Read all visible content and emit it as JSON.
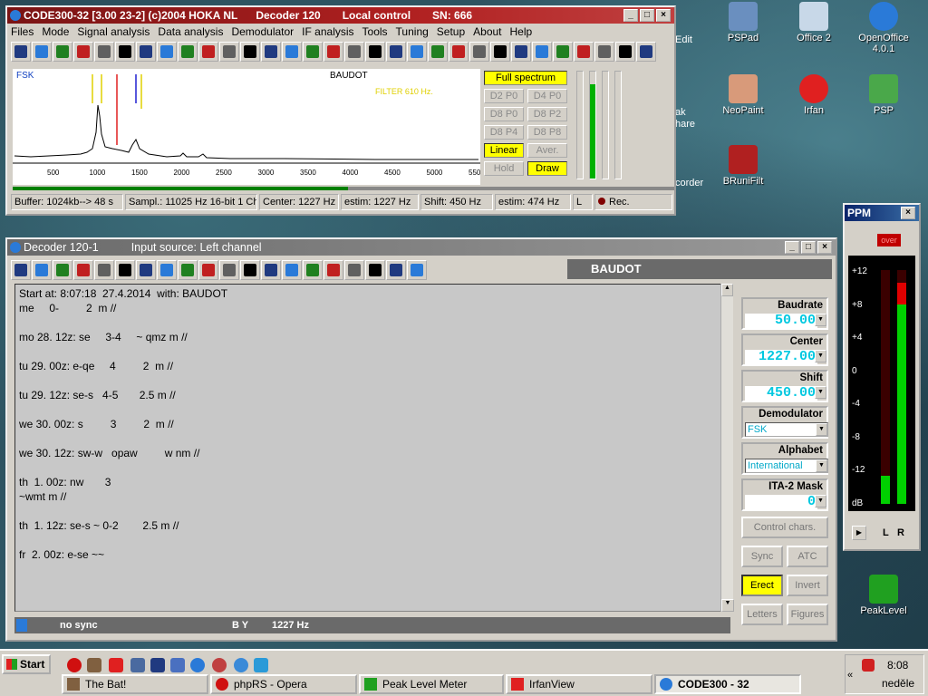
{
  "desktop": {
    "icons": [
      {
        "label": "PSPad",
        "color": "#6a8fbf"
      },
      {
        "label": "Office 2",
        "color": "#c8d8e8"
      },
      {
        "label": "OpenOffice\n4.0.1",
        "color": "#2a7ad8"
      },
      {
        "label": "NeoPaint",
        "color": "#d89a7a"
      },
      {
        "label": "Irfan",
        "color": "#e02020"
      },
      {
        "label": "PSP",
        "color": "#4aa84a"
      },
      {
        "label": "BRuniFilt",
        "color": "#b02020"
      },
      {
        "label": "PeakLevel",
        "color": "#20a020"
      }
    ],
    "partial_labels": [
      "Edit",
      "ak",
      "hare",
      "corder"
    ]
  },
  "main_window": {
    "title": "CODE300-32 [3.00 23-2] (c)2004 HOKA NL",
    "decoder": "Decoder 120",
    "control": "Local control",
    "sn": "SN: 666",
    "menu": [
      "Files",
      "Mode",
      "Signal analysis",
      "Data analysis",
      "Demodulator",
      "IF analysis",
      "Tools",
      "Tuning",
      "Setup",
      "About",
      "Help"
    ],
    "spectrum": {
      "mode_label": "FSK",
      "code_label": "BAUDOT",
      "filter_label": "FILTER 610 Hz.",
      "ticks": [
        "500",
        "1000",
        "1500",
        "2000",
        "2500",
        "3000",
        "3500",
        "4000",
        "4500",
        "5000",
        "550"
      ]
    },
    "spec_buttons": {
      "full": "Full spectrum",
      "d2p0": "D2 P0",
      "d4p0": "D4 P0",
      "d8p0": "D8 P0",
      "d8p2": "D8 P2",
      "d8p4": "D8 P4",
      "d8p8": "D8 P8",
      "linear": "Linear",
      "aver": "Aver.",
      "hold": "Hold",
      "draw": "Draw"
    },
    "status": {
      "buffer": "Buffer: 1024kb--> 48 s",
      "sampl": "Sampl.: 11025 Hz 16-bit 1 Ch",
      "center": "Center: 1227 Hz",
      "estim1": "estim: 1227 Hz",
      "shift": "Shift: 450 Hz",
      "estim2": "estim: 474 Hz",
      "channel": "L",
      "rec": "Rec."
    }
  },
  "decoder_window": {
    "title": "Decoder 120-1",
    "input_source": "Input source: Left channel",
    "mode": "BAUDOT",
    "text": "Start at: 8:07:18  27.4.2014  with: BAUDOT\nme     0-         2  m //\n\nmo 28. 12z: se     3-4     ~ qmz m //\n\ntu 29. 00z: e-qe     4         2  m //\n\ntu 29. 12z: se-s   4-5       2.5 m //\n\nwe 30. 00z: s         3         2  m //\n\nwe 30. 12z: sw-w   opaw         w nm //\n\nth  1. 00z: nw       3\n~wmt m //\n\nth  1. 12z: se-s ~ 0-2        2.5 m //\n\nfr  2. 00z: e-se ~~",
    "status": {
      "sync": "no sync",
      "chars": "B Y",
      "freq": "1227 Hz"
    },
    "panels": {
      "baudrate": {
        "label": "Baudrate",
        "value": "50.00"
      },
      "center": {
        "label": "Center",
        "value": "1227.00"
      },
      "shift": {
        "label": "Shift",
        "value": "450.00"
      },
      "demodulator": {
        "label": "Demodulator",
        "value": "FSK"
      },
      "alphabet": {
        "label": "Alphabet",
        "value": "International"
      },
      "ita2": {
        "label": "ITA-2 Mask",
        "value": "0"
      }
    },
    "buttons": {
      "control_chars": "Control chars.",
      "sync": "Sync",
      "atc": "ATC",
      "erect": "Erect",
      "invert": "Invert",
      "letters": "Letters",
      "figures": "Figures"
    }
  },
  "ppm_window": {
    "title": "PPM",
    "over": "over",
    "scale": [
      "+12",
      "+8",
      "+4",
      "0",
      "-4",
      "-8",
      "-12",
      "dB"
    ],
    "channels": [
      "L",
      "R"
    ],
    "levels": {
      "L": 0.12,
      "R": 0.9
    }
  },
  "taskbar": {
    "start": "Start",
    "tasks": [
      "The Bat!",
      "phpRS - Opera",
      "Peak Level Meter",
      "IrfanView",
      "CODE300 - 32"
    ],
    "time": "8:08",
    "day": "neděle",
    "colors": {
      "accent": "#0a246a"
    }
  }
}
